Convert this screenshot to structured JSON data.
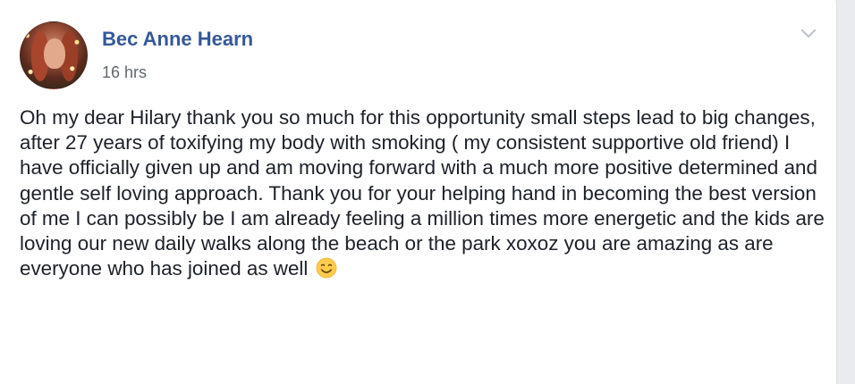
{
  "post": {
    "author_name": "Bec Anne Hearn",
    "timestamp": "16 hrs",
    "message": "Oh my dear Hilary thank you so much for this opportunity small steps lead to big changes, after 27 years of toxifying my body with smoking ( my consistent supportive old friend) I have officially given up and am moving forward with a much more positive determined and gentle self loving approach. Thank you for your helping hand in becoming the best version of me I can possibly be I am already feeling a million times more energetic and the kids are loving our new daily walks along the beach or the park xoxoz you are amazing as are everyone who has joined as well",
    "emoji": "smiling-face-icon",
    "avatar_icon": "profile-photo",
    "menu_icon": "chevron-down-icon"
  },
  "colors": {
    "author_link": "#365899",
    "text": "#1d2129",
    "meta": "#616770",
    "background": "#e9ebee",
    "card": "#ffffff"
  }
}
